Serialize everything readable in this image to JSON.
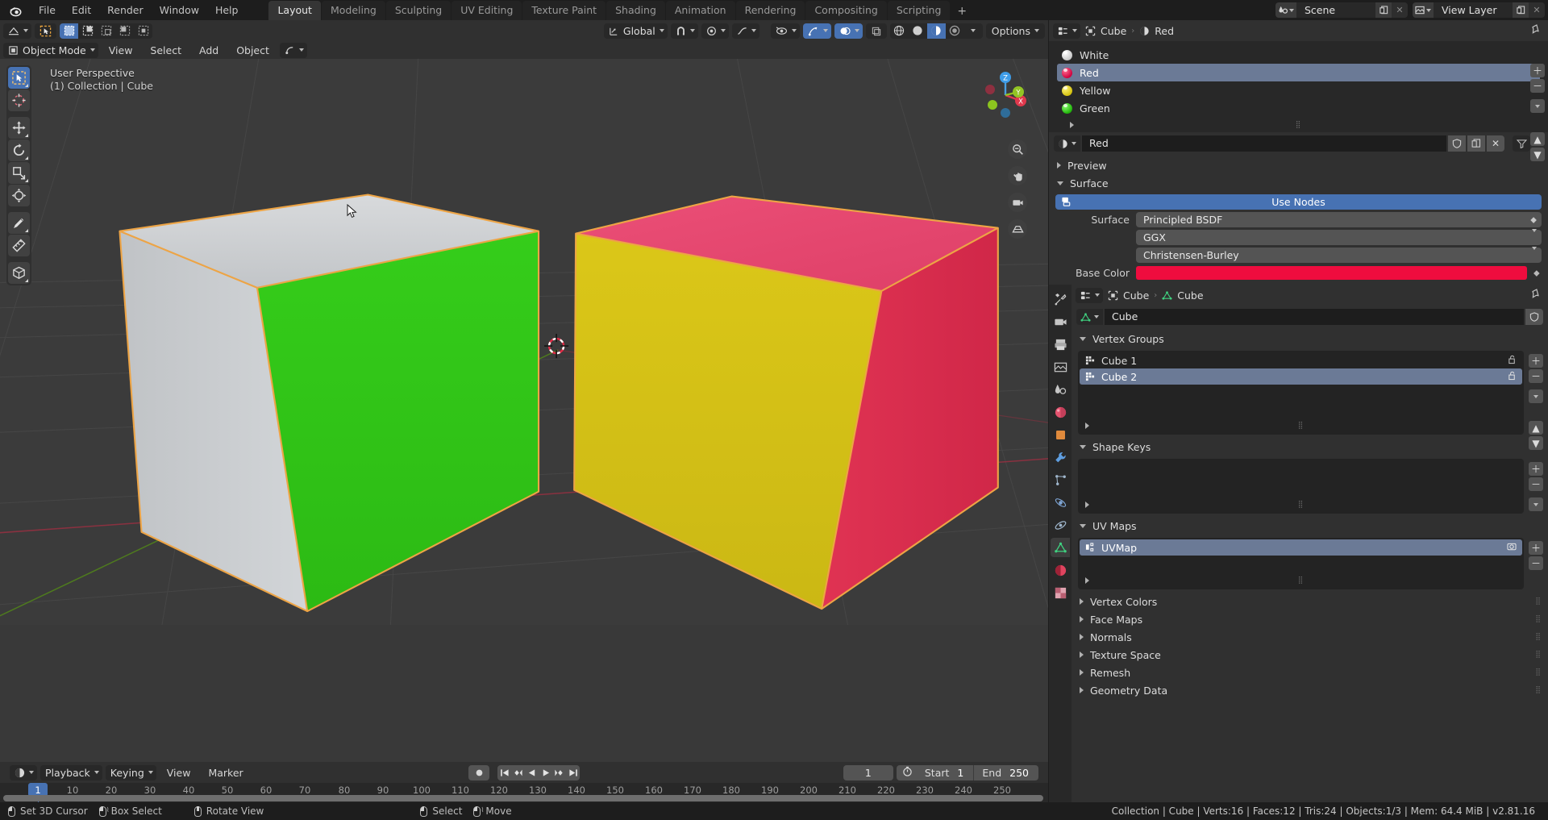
{
  "app": {
    "menus": [
      "File",
      "Edit",
      "Render",
      "Window",
      "Help"
    ],
    "workspace_tabs": [
      {
        "label": "Layout",
        "active": true
      },
      {
        "label": "Modeling",
        "active": false
      },
      {
        "label": "Sculpting",
        "active": false
      },
      {
        "label": "UV Editing",
        "active": false
      },
      {
        "label": "Texture Paint",
        "active": false
      },
      {
        "label": "Shading",
        "active": false
      },
      {
        "label": "Animation",
        "active": false
      },
      {
        "label": "Rendering",
        "active": false
      },
      {
        "label": "Compositing",
        "active": false
      },
      {
        "label": "Scripting",
        "active": false
      }
    ],
    "add_workspace": "+",
    "scene_name": "Scene",
    "view_layer_name": "View Layer",
    "logo_icon": "blender-logo-icon"
  },
  "viewport_header": {
    "editor_type_icon": "editor-type-icon",
    "mode": "Object Mode",
    "menus": [
      "View",
      "Select",
      "Add",
      "Object"
    ],
    "transform_orientation": "Global",
    "snap_icon": "magnet-icon",
    "proportional_icon": "proportional-edit-icon",
    "falloff_icon": "falloff-curve-icon",
    "visibility_icon": "visibility-icon",
    "gizmo_icon": "gizmo-icon",
    "overlays_icon": "overlays-icon",
    "xray_icon": "xray-icon",
    "shading_modes": [
      "wireframe",
      "solid",
      "material-preview",
      "rendered"
    ],
    "shading_active_index": 2,
    "options_label": "Options"
  },
  "viewport": {
    "overlay_line1": "User Perspective",
    "overlay_line2": "(1) Collection | Cube",
    "toolbar_tools": [
      {
        "name": "select-box-tool",
        "active": true
      },
      {
        "name": "cursor-tool",
        "active": false
      },
      {
        "name": "move-tool",
        "active": false
      },
      {
        "name": "rotate-tool",
        "active": false
      },
      {
        "name": "scale-tool",
        "active": false
      },
      {
        "name": "transform-tool",
        "active": false
      },
      {
        "name": "annotate-tool",
        "active": false
      },
      {
        "name": "measure-tool",
        "active": false
      },
      {
        "name": "add-cube-tool",
        "active": false
      }
    ],
    "gizmo_axes": [
      "X",
      "Y",
      "Z"
    ],
    "nav_buttons": [
      "zoom-icon",
      "pan-icon",
      "camera-icon",
      "perspective-icon"
    ],
    "objects": [
      {
        "name": "Cube-left",
        "faces": {
          "top": "#d4d6d8",
          "left": "#cbcdcf",
          "front": "#2ecc17"
        },
        "selected": true
      },
      {
        "name": "Cube-right",
        "faces": {
          "top": "#e44b72",
          "left": "#d4c116",
          "right": "#dc2b4e"
        },
        "selected": true
      }
    ],
    "selection_outline_color": "#ed9e46",
    "cursor_3d": "3d-cursor"
  },
  "timeline": {
    "editor_type_icon": "timeline-icon",
    "menus": [
      "Playback",
      "Keying",
      "View",
      "Marker"
    ],
    "record_icon": "record-icon",
    "transport": [
      "jump-to-start",
      "prev-keyframe",
      "play-reverse",
      "play",
      "next-keyframe",
      "jump-to-end"
    ],
    "current_frame": "1",
    "stopwatch_icon": "stopwatch-icon",
    "start_label": "Start",
    "start_value": "1",
    "end_label": "End",
    "end_value": "250",
    "ticks": [
      1,
      10,
      20,
      30,
      40,
      50,
      60,
      70,
      80,
      90,
      100,
      110,
      120,
      130,
      140,
      150,
      160,
      170,
      180,
      190,
      200,
      210,
      220,
      230,
      240,
      250
    ],
    "playhead_frame": "1"
  },
  "outliner": {
    "editor_type_icon": "properties-editor-icon",
    "breadcrumb": [
      {
        "icon": "object-icon",
        "label": "Cube"
      },
      {
        "icon": "material-icon",
        "label": "Red"
      }
    ],
    "pin_icon": "pin-icon",
    "material_slots": [
      {
        "label": "White",
        "color": "#e9e9e9",
        "selected": false
      },
      {
        "label": "Red",
        "color": "#e0114f",
        "selected": true
      },
      {
        "label": "Yellow",
        "color": "#e3d217",
        "selected": false
      },
      {
        "label": "Green",
        "color": "#2ec713",
        "selected": false
      }
    ],
    "side_buttons": [
      "add-slot-button",
      "remove-slot-button",
      "slot-menu-button"
    ]
  },
  "material_props": {
    "material_name": "Red",
    "browse_icon": "material-browse-icon",
    "shield_icon": "fake-user-icon",
    "copy_icon": "new-material-icon",
    "unlink_icon": "unlink-icon",
    "filter_icon": "filter-icon",
    "panels": [
      {
        "label": "Preview",
        "open": false
      },
      {
        "label": "Surface",
        "open": true
      }
    ],
    "use_nodes_label": "Use Nodes",
    "surface_label": "Surface",
    "surface_value": "Principled BSDF",
    "distribution_value": "GGX",
    "subsurface_method_value": "Christensen-Burley",
    "base_color_label": "Base Color",
    "base_color_value": "#ef0c3e"
  },
  "object_data_props": {
    "editor_type_icon": "properties-editor-icon",
    "breadcrumb": [
      {
        "icon": "object-icon",
        "label": "Cube"
      },
      {
        "icon": "mesh-data-icon",
        "label": "Cube"
      }
    ],
    "mesh_name": "Cube",
    "mesh_icon": "mesh-data-icon",
    "vertex_groups": {
      "label": "Vertex Groups",
      "open": true,
      "items": [
        {
          "label": "Cube 1",
          "selected": false,
          "lock_icon": "unlocked-icon"
        },
        {
          "label": "Cube 2",
          "selected": true,
          "lock_icon": "unlocked-icon"
        }
      ]
    },
    "shape_keys": {
      "label": "Shape Keys",
      "open": true,
      "items": []
    },
    "uv_maps": {
      "label": "UV Maps",
      "open": true,
      "items": [
        {
          "label": "UVMap",
          "selected": true,
          "camera_icon": "camera-icon"
        }
      ]
    },
    "collapsed_panels": [
      {
        "label": "Vertex Colors"
      },
      {
        "label": "Face Maps"
      },
      {
        "label": "Normals"
      },
      {
        "label": "Texture Space"
      },
      {
        "label": "Remesh"
      },
      {
        "label": "Geometry Data"
      }
    ]
  },
  "prop_tabs": [
    {
      "name": "tool-tab",
      "icon": "wrench-screwdriver-icon",
      "color": "#d7d7d7",
      "active": false
    },
    {
      "name": "render-tab",
      "icon": "camera-back-icon",
      "color": "#c9c9c9",
      "active": false
    },
    {
      "name": "output-tab",
      "icon": "printer-icon",
      "color": "#c9c9c9",
      "active": false
    },
    {
      "name": "view-layer-tab",
      "icon": "images-icon",
      "color": "#c9c9c9",
      "active": false
    },
    {
      "name": "scene-tab",
      "icon": "cone-sphere-icon",
      "color": "#c9c9c9",
      "active": false
    },
    {
      "name": "world-tab",
      "icon": "world-icon",
      "color": "#e4536f",
      "active": false
    },
    {
      "name": "object-tab",
      "icon": "orange-square-icon",
      "color": "#e08a3c",
      "active": false
    },
    {
      "name": "modifier-tab",
      "icon": "wrench-icon",
      "color": "#5f9ee0",
      "active": false
    },
    {
      "name": "particles-tab",
      "icon": "particles-icon",
      "color": "#9fb6cc",
      "active": false
    },
    {
      "name": "physics-tab",
      "icon": "physics-icon",
      "color": "#7fa6d6",
      "active": false
    },
    {
      "name": "constraints-tab",
      "icon": "constraint-icon",
      "color": "#9fb6cc",
      "active": false
    },
    {
      "name": "data-tab",
      "icon": "green-triangle-data-icon",
      "color": "#3fd07f",
      "active": true
    },
    {
      "name": "material-tab",
      "icon": "material-sphere-icon",
      "color": "#e0445f",
      "active": false
    },
    {
      "name": "texture-tab",
      "icon": "checker-texture-icon",
      "color": "#e07a8c",
      "active": false
    }
  ],
  "statusbar": {
    "hints": [
      {
        "mouse": "left",
        "label": "Set 3D Cursor"
      },
      {
        "mouse": "left-drag",
        "label": "Box Select"
      },
      {
        "mouse": "middle",
        "label": "Rotate View"
      },
      {
        "mouse": "left2",
        "label": "Select"
      },
      {
        "mouse": "left-drag2",
        "label": "Move"
      }
    ],
    "info": "Collection | Cube | Verts:16 | Faces:12 | Tris:24 | Objects:1/3 | Mem: 64.4 MiB | v2.81.16"
  }
}
